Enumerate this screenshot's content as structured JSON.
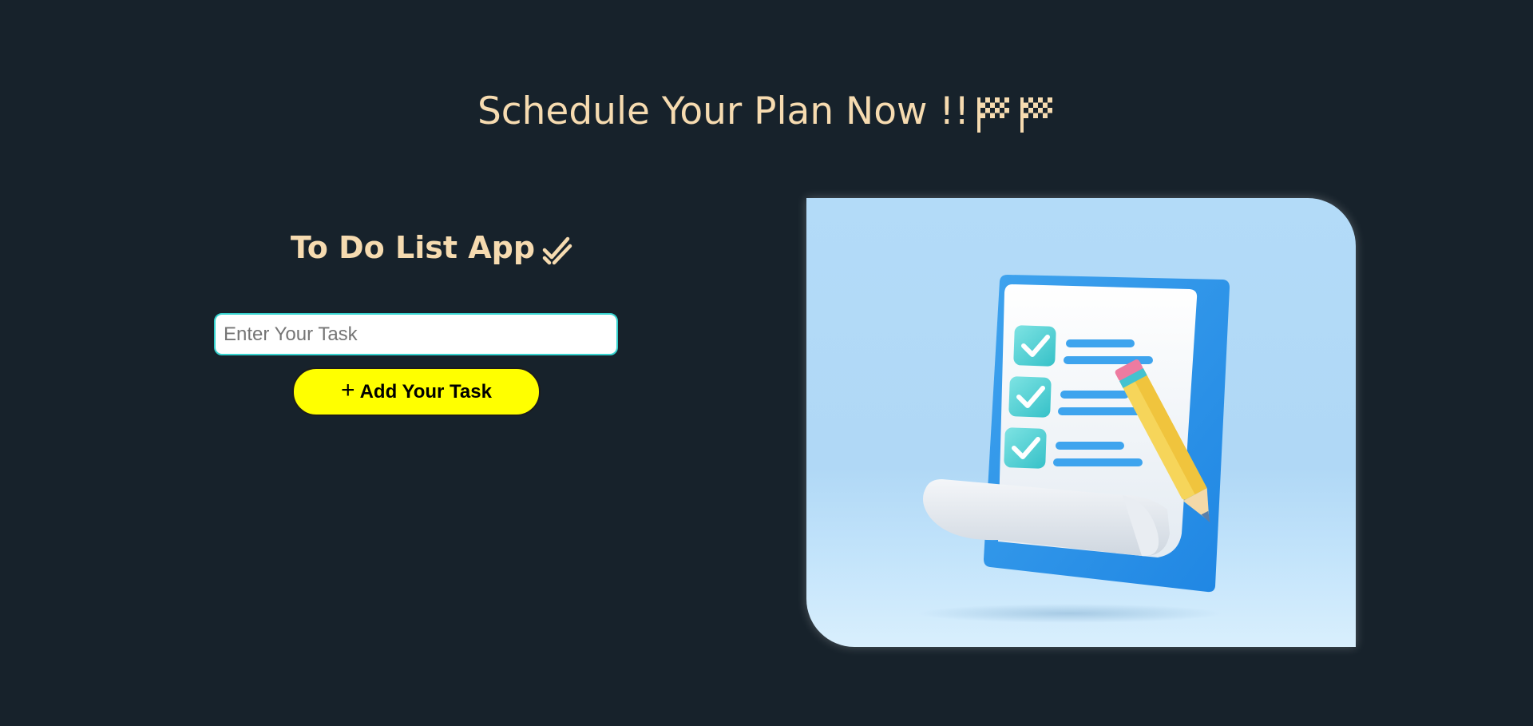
{
  "header": {
    "title": "Schedule Your Plan Now !!"
  },
  "app": {
    "title": "To Do List App",
    "input": {
      "placeholder": "Enter Your Task",
      "value": ""
    },
    "add_button": {
      "label": "Add Your Task"
    }
  },
  "colors": {
    "background": "#17222b",
    "title_text": "#f6dbb0",
    "input_border": "#36d3cf",
    "button_bg": "#ffff00"
  },
  "icons": {
    "flag_1": "checkered-flag-icon",
    "flag_2": "checkered-flag-icon",
    "double_check": "double-check-icon",
    "plus": "plus-icon"
  }
}
